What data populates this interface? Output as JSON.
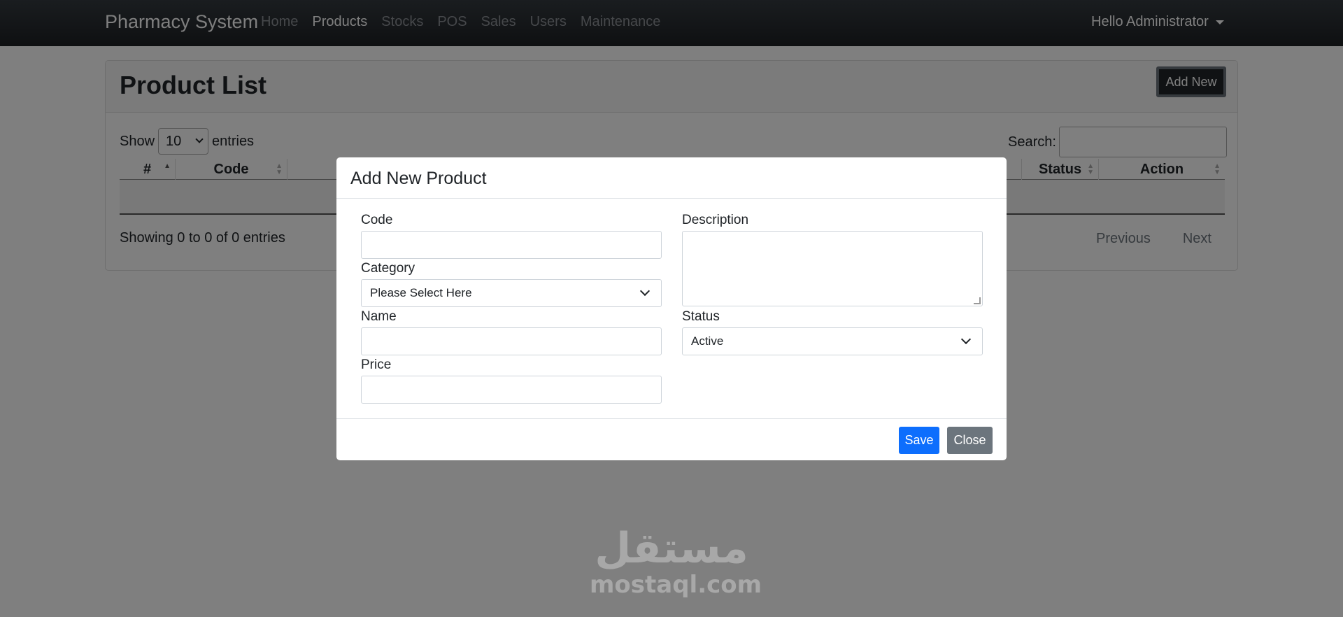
{
  "navbar": {
    "brand": "Pharmacy System",
    "links": [
      "Home",
      "Products",
      "Stocks",
      "POS",
      "Sales",
      "Users",
      "Maintenance"
    ],
    "active_link": "Products",
    "user": "Hello Administrator"
  },
  "page": {
    "title": "Product List",
    "add_new_label": "Add New",
    "show_label": "Show",
    "entries_value": "10",
    "entries_label": "entries",
    "search_label": "Search:",
    "columns": [
      "#",
      "Code",
      "",
      "Status",
      "Action"
    ],
    "info": "Showing 0 to 0 of 0 entries",
    "previous_label": "Previous",
    "next_label": "Next"
  },
  "modal": {
    "title": "Add New Product",
    "code_label": "Code",
    "category_label": "Category",
    "category_value": "Please Select Here",
    "name_label": "Name",
    "price_label": "Price",
    "description_label": "Description",
    "status_label": "Status",
    "status_value": "Active",
    "save_label": "Save",
    "close_label": "Close"
  },
  "watermark": {
    "logo_text": "مستقل",
    "site": "mostaql.com"
  }
}
